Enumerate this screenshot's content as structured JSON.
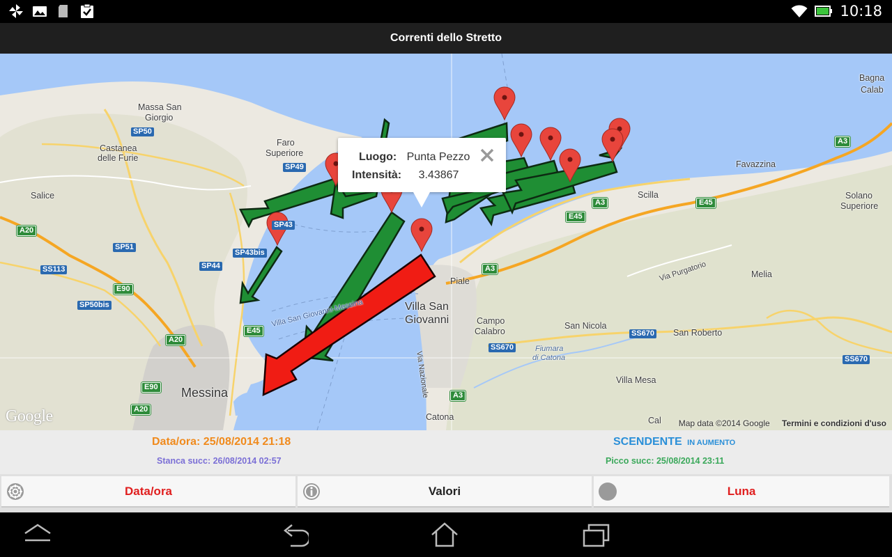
{
  "status_bar": {
    "time": "10:18",
    "icons": [
      "pinwheel-icon",
      "picture-icon",
      "sd-card-icon",
      "clipboard-check-icon",
      "wifi-icon",
      "battery-icon"
    ]
  },
  "app_title": "Correnti dello Stretto",
  "map": {
    "labels": {
      "massa_san_giorgio_1": "Massa San",
      "massa_san_giorgio_2": "Giorgio",
      "castanea_1": "Castanea",
      "castanea_2": "delle Furie",
      "faro_1": "Faro",
      "faro_2": "Superiore",
      "salice": "Salice",
      "messina": "Messina",
      "villa_san_giovanni_1": "Villa San",
      "villa_san_giovanni_2": "Giovanni",
      "piale": "Piale",
      "campo_calabro_1": "Campo",
      "campo_calabro_2": "Calabro",
      "catona": "Catona",
      "san_nicola": "San Nicola",
      "san_roberto": "San Roberto",
      "villa_mesa": "Villa Mesa",
      "scilla": "Scilla",
      "favazzina": "Favazzina",
      "solano_1": "Solano",
      "solano_2": "Superiore",
      "melia": "Melia",
      "via_purgatorio": "Via Purgatorio",
      "bagnara_1": "Bagna",
      "bagnara_2": "Calab",
      "fiumara_1": "Fiumara",
      "fiumara_2": "di Catona",
      "via_nazionale": "Via Nazionale",
      "villa_sg_road": "Villa San Giovanni-Messina",
      "cal": "Cal"
    },
    "shields": {
      "sp50": "SP50",
      "sp49": "SP49",
      "sp43": "SP43",
      "sp43bis": "SP43bis",
      "a20_1": "A20",
      "sp51": "SP51",
      "ss113": "SS113",
      "sp44": "SP44",
      "e90_1": "E90",
      "sp50bis": "SP50bis",
      "e45_1": "E45",
      "a20_2": "A20",
      "e90_2": "E90",
      "a20_3": "A20",
      "a3_1": "A3",
      "a3_2": "A3",
      "a3_3": "A3",
      "a3_4": "A3",
      "e45_2": "E45",
      "e45_3": "E45",
      "ss670_1": "SS670",
      "ss670_2": "SS670",
      "ss670_3": "SS670"
    },
    "infowindow": {
      "place_label": "Luogo:",
      "place_value": "Punta Pezzo",
      "intensity_label": "Intensità:",
      "intensity_value": "3.43867"
    },
    "credits_data": "Map data ©2014 Google",
    "credits_terms": "Termini e condizioni d'uso",
    "google_logo": "Google"
  },
  "info_panel": {
    "datetime": "Data/ora: 25/08/2014 21:18",
    "next_slack": "Stanca succ: 26/08/2014 02:57",
    "tide_state": "SCENDENTE",
    "tide_trend": "IN AUMENTO",
    "next_peak": "Picco succ: 25/08/2014 23:11"
  },
  "buttons": {
    "datetime": "Data/ora",
    "values": "Valori",
    "moon": "Luna"
  },
  "colors": {
    "title_bar": "#1f1f1f",
    "sea": "#a5c8f8",
    "arrow_green": "#1f8e34",
    "arrow_red": "#f01c14",
    "orange_text": "#f08a1c",
    "purple_text": "#7b6fd6",
    "blue_text": "#2a8fd8",
    "green_text": "#3aa85a",
    "red_button_text": "#e01e1e"
  }
}
